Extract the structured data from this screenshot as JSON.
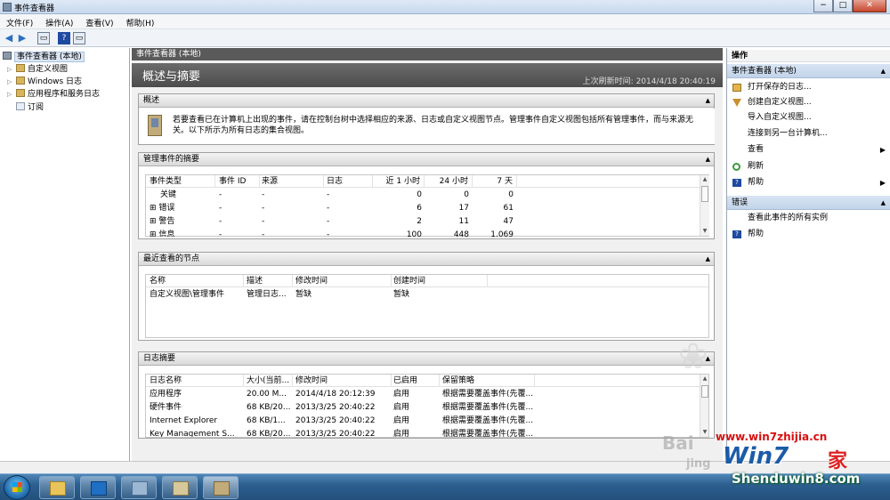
{
  "window": {
    "title": "事件查看器",
    "minimize": "−",
    "maximize": "□",
    "close": "✕"
  },
  "menu": [
    "文件(F)",
    "操作(A)",
    "查看(V)",
    "帮助(H)"
  ],
  "tree": {
    "root": "事件查看器 (本地)",
    "items": [
      "自定义视图",
      "Windows 日志",
      "应用程序和服务日志",
      "订阅"
    ]
  },
  "center": {
    "header": "事件查看器 (本地)",
    "title": "概述与摘要",
    "refresh": "上次刷新时间: 2014/4/18 20:40:19",
    "overview": {
      "heading": "概述",
      "text": "若要查看已在计算机上出现的事件，请在控制台树中选择相应的来源、日志或自定义视图节点。管理事件自定义视图包括所有管理事件，而与来源无关。以下所示为所有日志的集合视图。"
    },
    "admin_summary": {
      "heading": "管理事件的摘要",
      "columns": [
        "事件类型",
        "事件 ID",
        "来源",
        "日志",
        "近 1 小时",
        "24 小时",
        "7 天"
      ],
      "rows": [
        [
          "关键",
          "-",
          "-",
          "-",
          "0",
          "0",
          "0"
        ],
        [
          "⊞ 错误",
          "-",
          "-",
          "-",
          "6",
          "17",
          "61"
        ],
        [
          "⊞ 警告",
          "-",
          "-",
          "-",
          "2",
          "11",
          "47"
        ],
        [
          "⊞ 信息",
          "-",
          "-",
          "-",
          "100",
          "448",
          "1,069"
        ]
      ]
    },
    "recent_nodes": {
      "heading": "最近查看的节点",
      "columns": [
        "名称",
        "描述",
        "修改时间",
        "创建时间"
      ],
      "rows": [
        [
          "自定义视图\\管理事件",
          "管理日志...",
          "暂缺",
          "暂缺"
        ]
      ]
    },
    "log_summary": {
      "heading": "日志摘要",
      "columns": [
        "日志名称",
        "大小(当前...",
        "修改时间",
        "已启用",
        "保留策略"
      ],
      "rows": [
        [
          "应用程序",
          "20.00 M...",
          "2014/4/18 20:12:39",
          "启用",
          "根据需要覆盖事件(先覆..."
        ],
        [
          "硬件事件",
          "68 KB/20...",
          "2013/3/25 20:40:22",
          "启用",
          "根据需要覆盖事件(先覆..."
        ],
        [
          "Internet Explorer",
          "68 KB/1...",
          "2013/3/25 20:40:22",
          "启用",
          "根据需要覆盖事件(先覆..."
        ],
        [
          "Key Management S...",
          "68 KB/20...",
          "2013/3/25 20:40:22",
          "启用",
          "根据需要覆盖事件(先覆..."
        ]
      ]
    }
  },
  "actions": {
    "header": "操作",
    "group1": "事件查看器 (本地)",
    "items1": [
      "打开保存的日志...",
      "创建自定义视图...",
      "导入自定义视图...",
      "连接到另一台计算机...",
      "查看",
      "刷新",
      "帮助"
    ],
    "group2": "错误",
    "items2": [
      "查看此事件的所有实例",
      "帮助"
    ]
  },
  "watermark": {
    "site1": "www.win7zhijia.cn",
    "logo": "Win7",
    "logo_suffix": "家",
    "site2": "Shenduwin8.com",
    "small": "jing",
    "brand": "Bai"
  }
}
